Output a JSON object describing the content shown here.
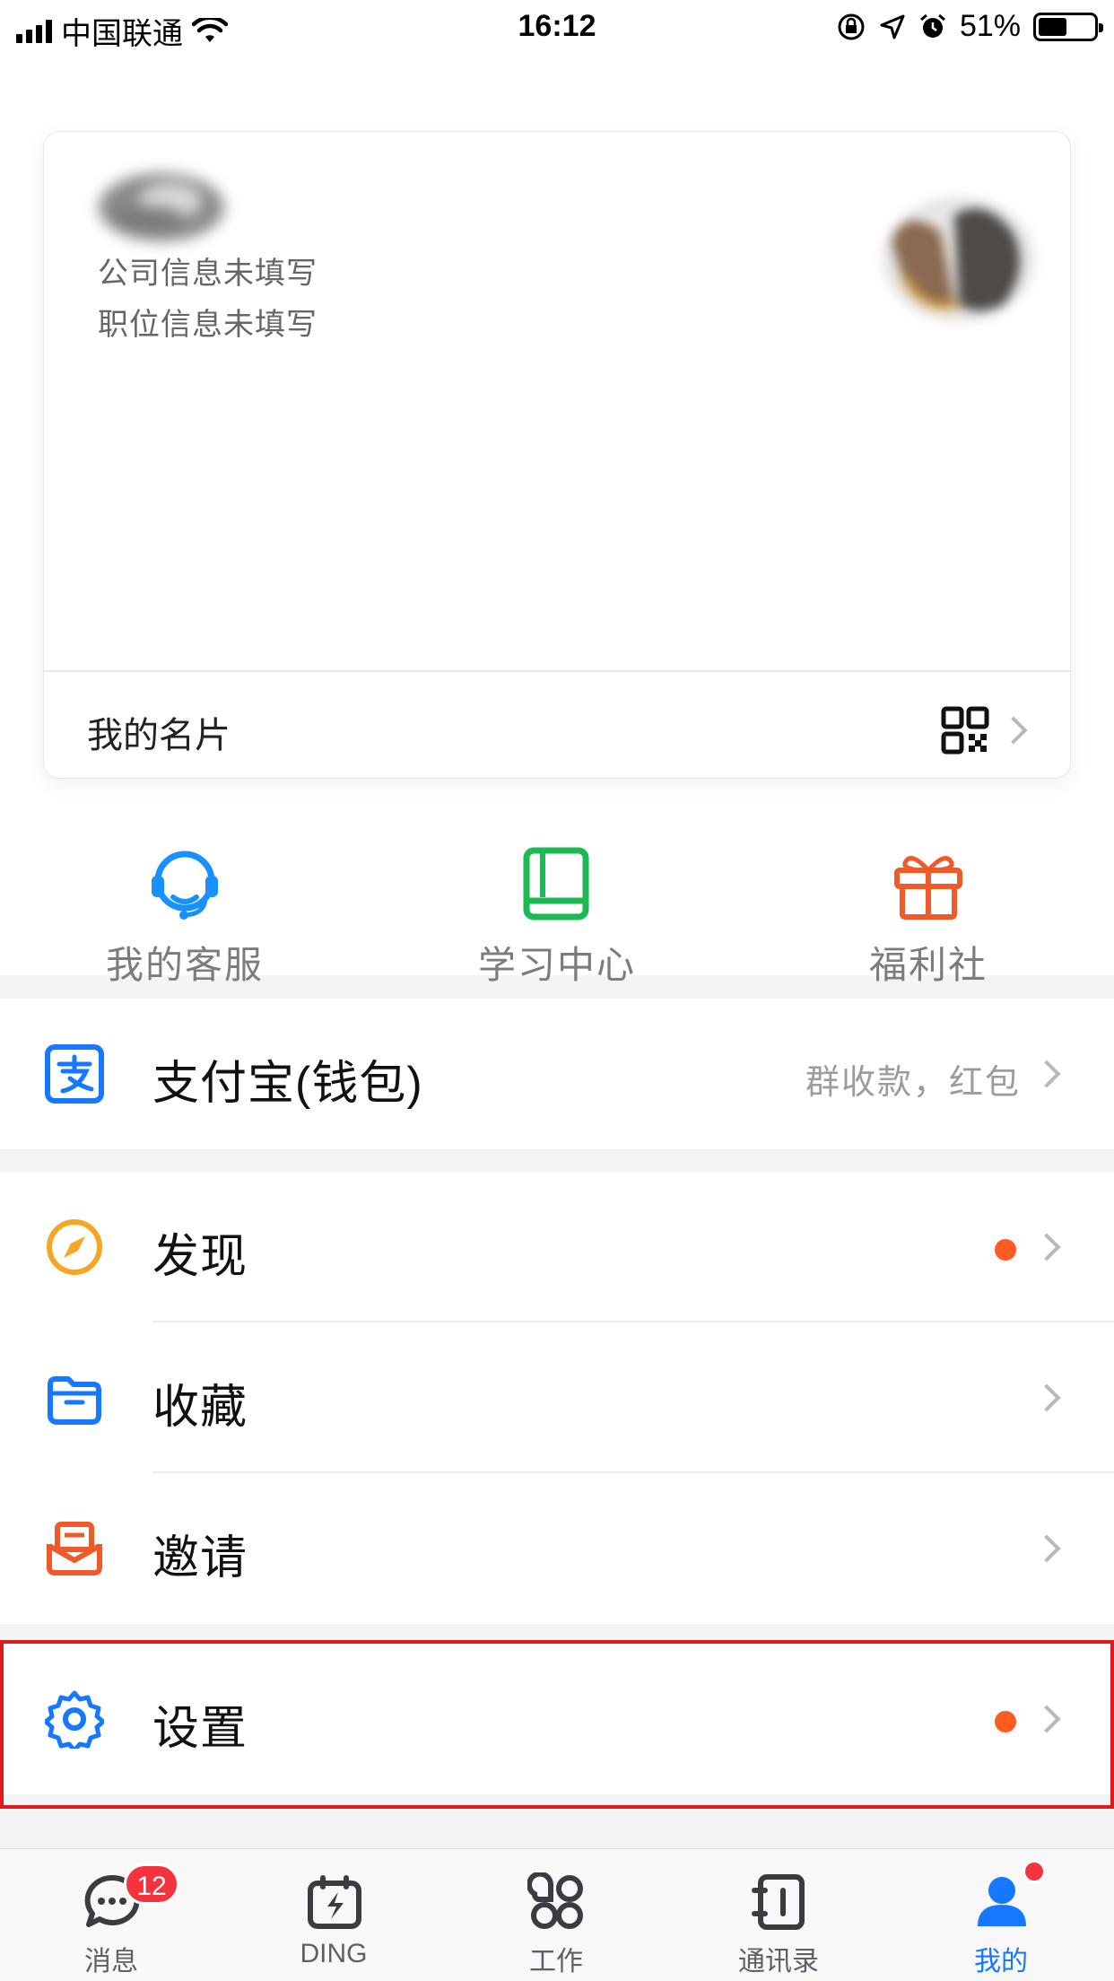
{
  "status_bar": {
    "carrier": "中国联通",
    "time": "16:12",
    "battery": "51%",
    "battery_level": 0.51
  },
  "profile_card": {
    "company": "公司信息未填写",
    "position": "职位信息未填写",
    "footer_label": "我的名片"
  },
  "shortcuts": [
    {
      "label": "我的客服",
      "icon": "customer-service-icon",
      "color": "#1890ff"
    },
    {
      "label": "学习中心",
      "icon": "book-icon",
      "color": "#1db954"
    },
    {
      "label": "福利社",
      "icon": "gift-icon",
      "color": "#f05a28"
    }
  ],
  "alipay": {
    "label": "支付宝(钱包)",
    "subtitle": "群收款，红包",
    "icon": "alipay-icon",
    "color": "#1677ff"
  },
  "menu": [
    {
      "label": "发现",
      "icon": "compass-icon",
      "color": "#f5a623",
      "has_dot": true
    },
    {
      "label": "收藏",
      "icon": "folder-icon",
      "color": "#1677ff",
      "has_dot": false
    },
    {
      "label": "邀请",
      "icon": "invite-icon",
      "color": "#f05a28",
      "has_dot": false
    }
  ],
  "settings": {
    "label": "设置",
    "icon": "gear-icon",
    "color": "#1677ff",
    "has_dot": true
  },
  "tabs": [
    {
      "label": "消息",
      "icon": "chat-icon",
      "badge": "12"
    },
    {
      "label": "DING",
      "icon": "ding-icon"
    },
    {
      "label": "工作",
      "icon": "work-grid-icon"
    },
    {
      "label": "通讯录",
      "icon": "contacts-icon"
    },
    {
      "label": "我的",
      "icon": "profile-icon",
      "active": true
    }
  ],
  "colors": {
    "accent": "#1677ff",
    "notification_dot": "#ff5a1f",
    "highlight_border": "#e0191e"
  }
}
